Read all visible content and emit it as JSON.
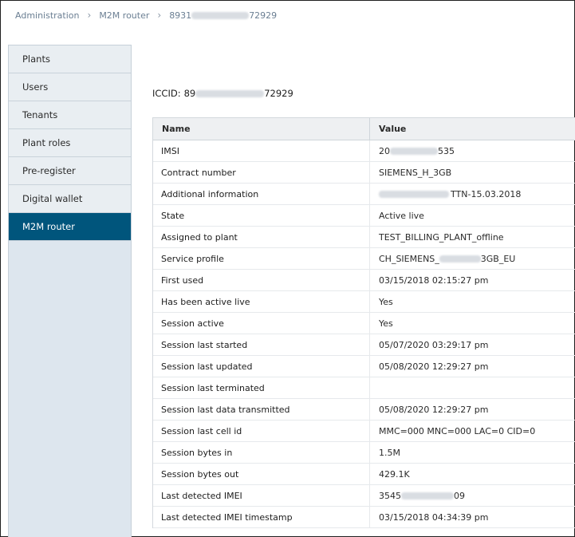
{
  "breadcrumb": {
    "items": [
      "Administration",
      "M2M router"
    ],
    "current_prefix": "8931",
    "current_suffix": "72929"
  },
  "sidebar": {
    "items": [
      {
        "label": "Plants"
      },
      {
        "label": "Users"
      },
      {
        "label": "Tenants"
      },
      {
        "label": "Plant roles"
      },
      {
        "label": "Pre-register"
      },
      {
        "label": "Digital wallet"
      },
      {
        "label": "M2M router",
        "active": true
      }
    ]
  },
  "iccid": {
    "label": "ICCID:",
    "prefix": "89",
    "suffix": "72929"
  },
  "table": {
    "columns": [
      "Name",
      "Value"
    ],
    "rows": [
      {
        "name": "IMSI",
        "pre": "20",
        "post": "535"
      },
      {
        "name": "Contract number",
        "value": "SIEMENS_H_3GB"
      },
      {
        "name": "Additional information",
        "pre": "",
        "post": "TTN-15.03.2018"
      },
      {
        "name": "State",
        "value": "Active live"
      },
      {
        "name": "Assigned to plant",
        "value": "TEST_BILLING_PLANT_offline"
      },
      {
        "name": "Service profile",
        "pre": "CH_SIEMENS_",
        "post": "3GB_EU"
      },
      {
        "name": "First used",
        "value": "03/15/2018 02:15:27 pm"
      },
      {
        "name": "Has been active live",
        "value": "Yes"
      },
      {
        "name": "Session active",
        "value": "Yes"
      },
      {
        "name": "Session last started",
        "value": "05/07/2020 03:29:17 pm"
      },
      {
        "name": "Session last updated",
        "value": "05/08/2020 12:29:27 pm"
      },
      {
        "name": "Session last terminated",
        "value": ""
      },
      {
        "name": "Session last data transmitted",
        "value": "05/08/2020 12:29:27 pm"
      },
      {
        "name": "Session last cell id",
        "value": "MMC=000 MNC=000 LAC=0 CID=0"
      },
      {
        "name": "Session bytes in",
        "value": "1.5M"
      },
      {
        "name": "Session bytes out",
        "value": "429.1K"
      },
      {
        "name": "Last detected IMEI",
        "pre": "3545",
        "post": "09"
      },
      {
        "name": "Last detected IMEI timestamp",
        "value": "03/15/2018 04:34:39 pm"
      }
    ]
  },
  "colors": {
    "accent": "#00557c",
    "sidebar": "#e9eef2",
    "link": "#6b7f93"
  }
}
